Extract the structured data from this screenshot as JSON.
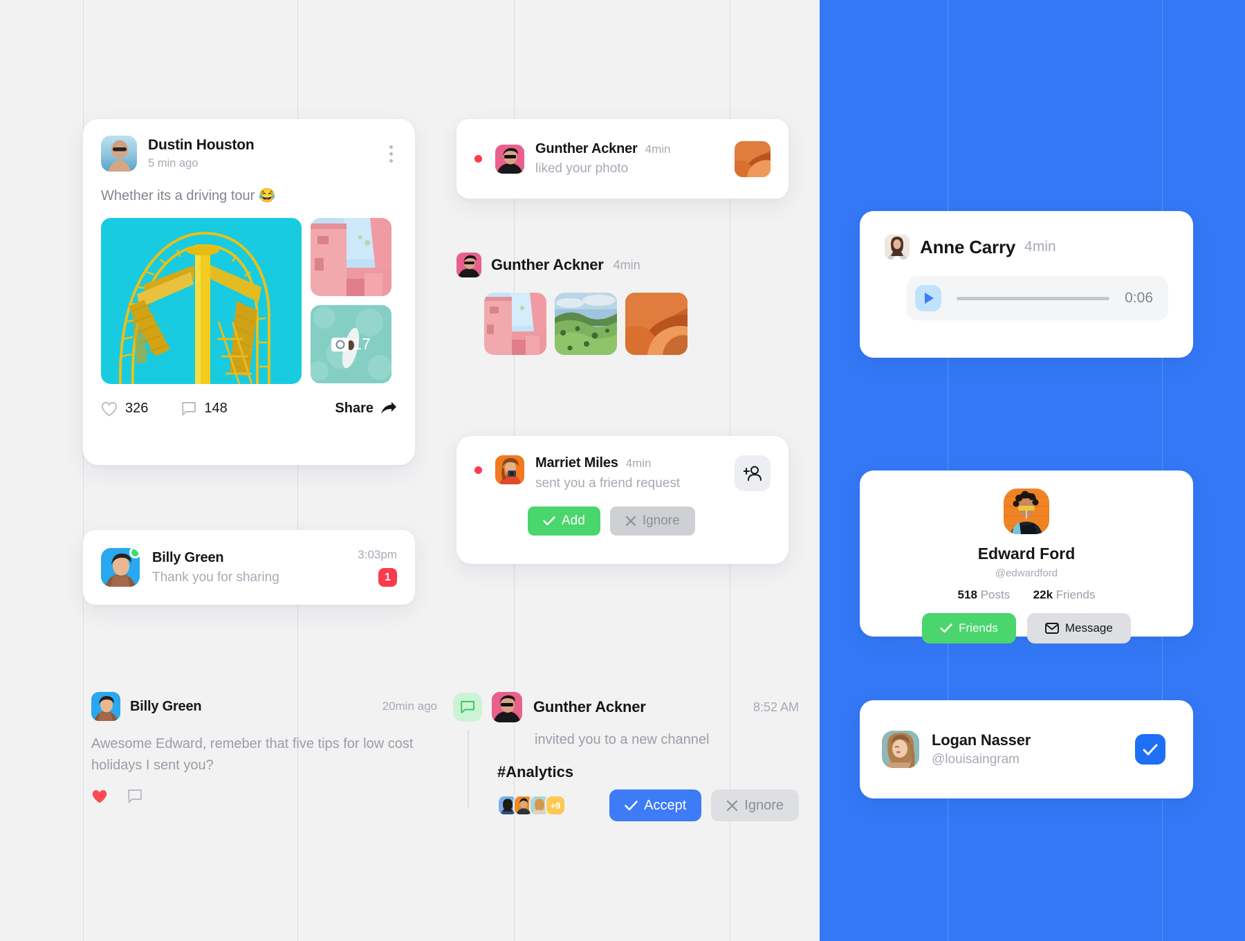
{
  "theme": {
    "background": "#f2f2f3",
    "panel_blue": "#3478f6",
    "accent_blue": "#3d7bf7",
    "accent_green": "#4ad66d",
    "accent_red": "#fb3b49",
    "text_dark": "#15161a",
    "text_muted": "#a7a9b4"
  },
  "post": {
    "author": "Dustin Houston",
    "time": "5 min ago",
    "text": "Whether its a driving tour 😂",
    "more_photos_count": "17",
    "likes": "326",
    "comments": "148",
    "share_label": "Share"
  },
  "message": {
    "name": "Billy Green",
    "preview": "Thank you for sharing",
    "time": "3:03pm",
    "unread": "1"
  },
  "comment": {
    "name": "Billy Green",
    "time": "20min ago",
    "body": "Awesome Edward, remeber that five tips for low cost holidays I sent you?"
  },
  "liked": {
    "name": "Gunther Ackner",
    "time": "4min",
    "action": "liked your photo"
  },
  "photo_post": {
    "name": "Gunther Ackner",
    "time": "4min"
  },
  "friend_request": {
    "name": "Marriet Miles",
    "time": "4min",
    "action": "sent you a friend request",
    "add_label": "Add",
    "ignore_label": "Ignore"
  },
  "channel_invite": {
    "name": "Gunther Ackner",
    "time": "8:52 AM",
    "action": "invited you to a new channel",
    "channel": "#Analytics",
    "extra_members": "+9",
    "accept_label": "Accept",
    "ignore_label": "Ignore"
  },
  "audio": {
    "name": "Anne Carry",
    "time": "4min",
    "duration": "0:06"
  },
  "profile": {
    "name": "Edward Ford",
    "handle": "@edwardford",
    "posts_count": "518",
    "posts_label": "Posts",
    "friends_count": "22k",
    "friends_label": "Friends",
    "friends_button": "Friends",
    "message_button": "Message"
  },
  "logan": {
    "name": "Logan Nasser",
    "handle": "@louisaingram"
  }
}
